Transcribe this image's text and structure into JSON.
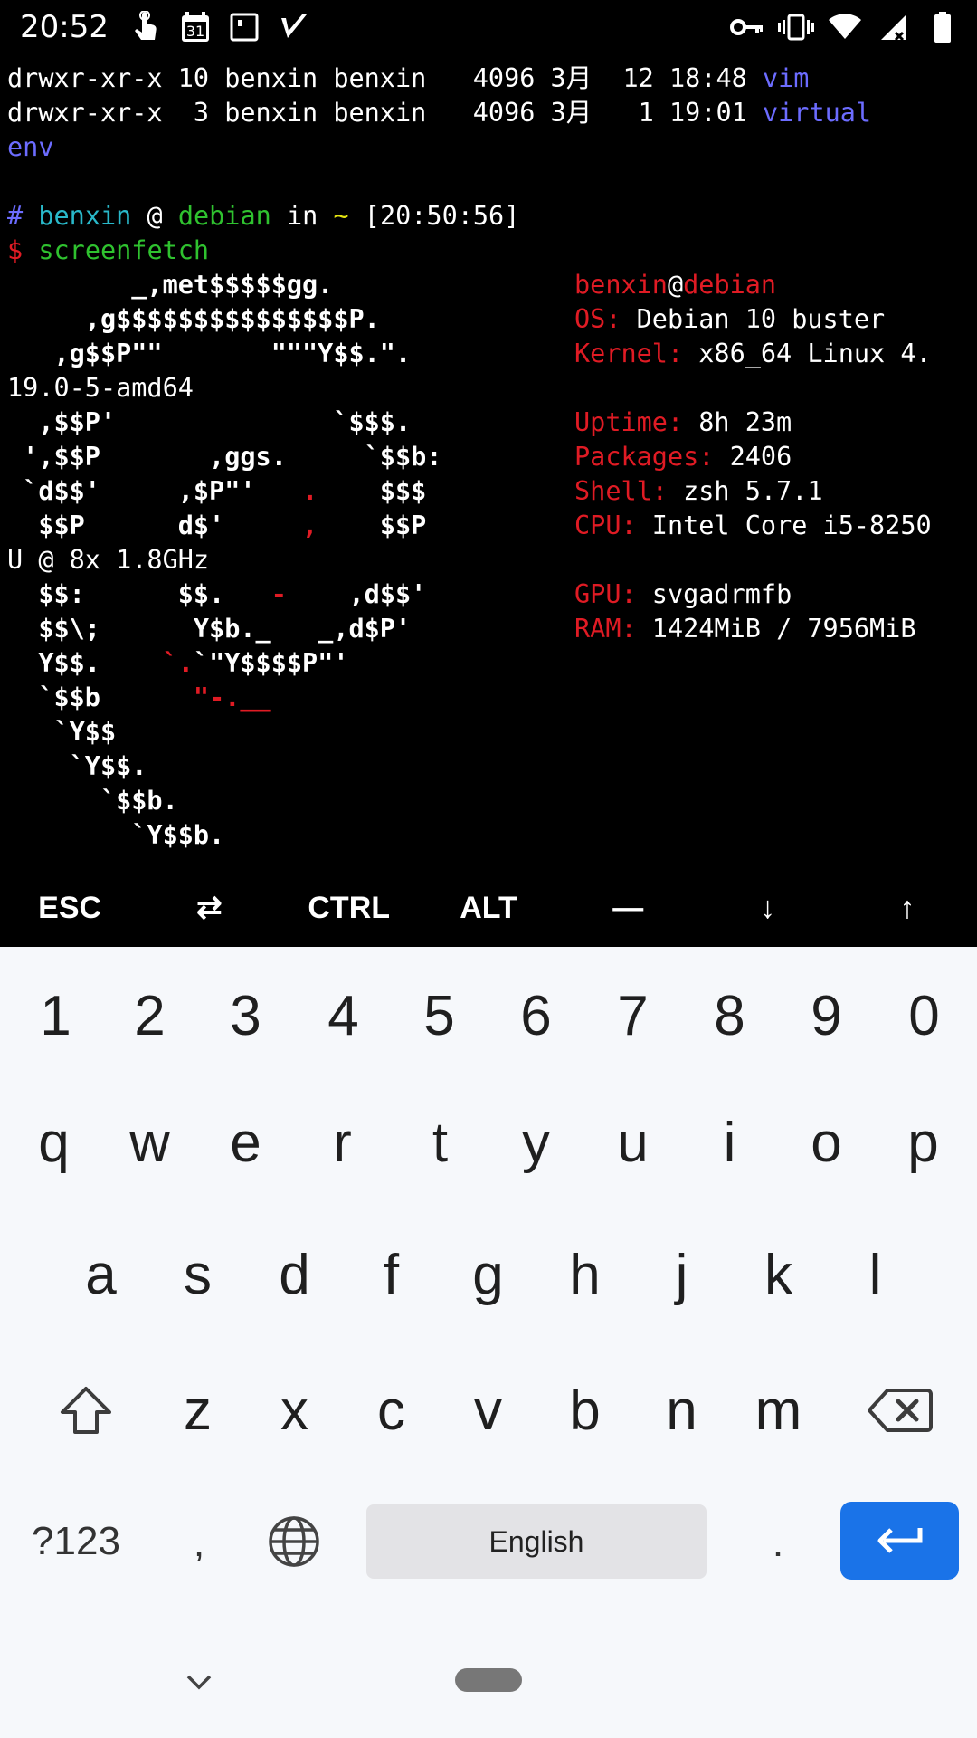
{
  "status_bar": {
    "time": "20:52",
    "calendar_day": "31",
    "left_icons": [
      "touch-icon",
      "calendar-icon",
      "app-square-icon",
      "check-icon"
    ],
    "right_icons": [
      "vpn-key-icon",
      "vibrate-icon",
      "wifi-icon",
      "signal-icon",
      "battery-icon"
    ]
  },
  "terminal": {
    "ls_lines": [
      {
        "perm": "drwxr-xr-x 10 benxin benxin   4096 3月  12 18:48 ",
        "name": "vim"
      },
      {
        "perm": "drwxr-xr-x  3 benxin benxin   4096 3月   1 19:01 ",
        "name": "virtual"
      },
      {
        "perm": "",
        "name": "env"
      }
    ],
    "prompt": {
      "hash": "#",
      "user": "benxin",
      "at": "@",
      "host": "debian",
      "in": "in",
      "tilde": "~",
      "time": "[20:50:56]",
      "dollar": "$",
      "command": "screenfetch"
    },
    "logo": {
      "l1": "        _,met$$$$$gg.",
      "l2": "     ,g$$$$$$$$$$$$$$$P.",
      "l3": "   ,g$$P\"\"       \"\"\"Y$$.\".",
      "wrap": "19.0-5-amd64",
      "l4": "  ,$$P'              `$$$.",
      "l5": " ',$$P       ,ggs.     `$$b:",
      "l6a": " `d$$'     ,$P\"'   ",
      "l6b": ".",
      "l6c": "    $$$",
      "l7a": "  $$P      d$'     ",
      "l7b": ",",
      "l7c": "    $$P",
      "wrap2": "U @ 8x 1.8GHz",
      "l8a": "  $$:      $$.   ",
      "l8b": "-",
      "l8c": "    ,d$$'",
      "l9": "  $$\\;      Y$b._   _,d$P'",
      "l10a": "  Y$$.    ",
      "l10b": "`.",
      "l10c": "`\"Y$$$$P\"'",
      "l11a": "  `$$b      ",
      "l11b": "\"-.__",
      "l12": "   `Y$$",
      "l13": "    `Y$$.",
      "l14": "      `$$b.",
      "l15": "        `Y$$b."
    },
    "info": {
      "user": "benxin",
      "at": "@",
      "host": "debian",
      "os_label": "OS:",
      "os_value": " Debian 10 buster",
      "kernel_label": "Kernel:",
      "kernel_value": " x86_64 Linux 4.",
      "uptime_label": "Uptime:",
      "uptime_value": " 8h 23m",
      "packages_label": "Packages:",
      "packages_value": " 2406",
      "shell_label": "Shell:",
      "shell_value": " zsh 5.7.1",
      "cpu_label": "CPU:",
      "cpu_value": " Intel Core i5-8250",
      "gpu_label": "GPU:",
      "gpu_value": " svgadrmfb",
      "ram_label": "RAM:",
      "ram_value": " 1424MiB / 7956MiB"
    }
  },
  "extra_keys": [
    "ESC",
    "⇄",
    "CTRL",
    "ALT",
    "—",
    "↓",
    "↑"
  ],
  "keyboard": {
    "row_numbers": [
      "1",
      "2",
      "3",
      "4",
      "5",
      "6",
      "7",
      "8",
      "9",
      "0"
    ],
    "row1": [
      "q",
      "w",
      "e",
      "r",
      "t",
      "y",
      "u",
      "i",
      "o",
      "p"
    ],
    "row2": [
      "a",
      "s",
      "d",
      "f",
      "g",
      "h",
      "j",
      "k",
      "l"
    ],
    "row3": [
      "z",
      "x",
      "c",
      "v",
      "b",
      "n",
      "m"
    ],
    "symbols": "?123",
    "comma": ",",
    "space_label": "English",
    "period": "."
  },
  "colors": {
    "accent_blue": "#1a73e8",
    "terminal_red": "#e01b24",
    "terminal_blue": "#6c6cff",
    "terminal_cyan": "#29b8c9",
    "terminal_green": "#2fc22f",
    "keyboard_bg": "#f6f8fb"
  }
}
